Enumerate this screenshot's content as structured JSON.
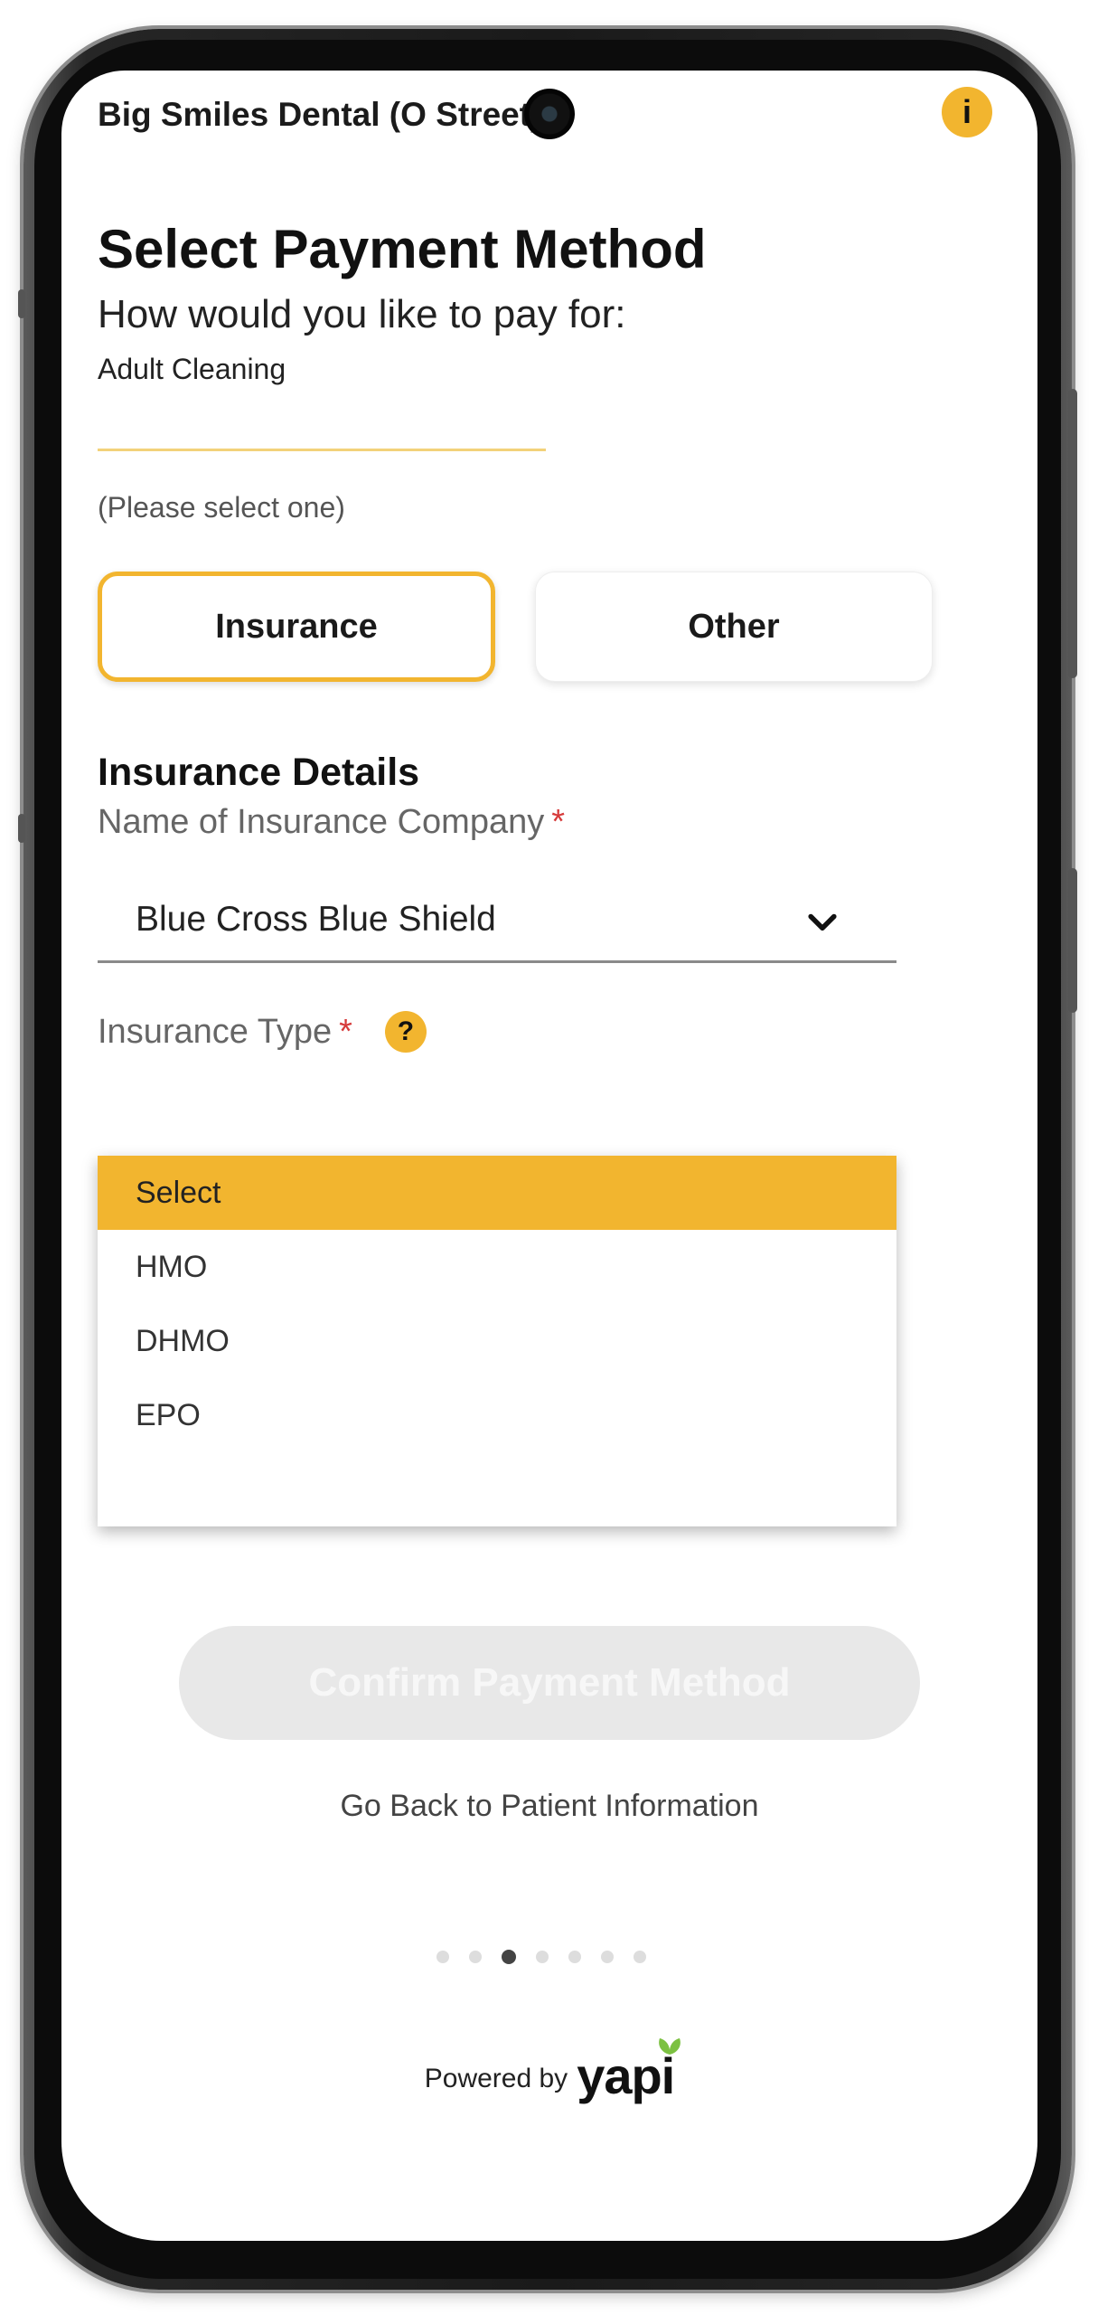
{
  "header": {
    "practice_name": "Big Smiles Dental (O Street)",
    "info_label": "i"
  },
  "main": {
    "title": "Select Payment Method",
    "subtitle": "How would you like to pay for:",
    "service_name": "Adult Cleaning",
    "select_hint": "(Please select one)",
    "payment_options": [
      {
        "label": "Insurance",
        "selected": true
      },
      {
        "label": "Other",
        "selected": false
      }
    ]
  },
  "insurance_details": {
    "section_title": "Insurance Details",
    "company_label": "Name of Insurance Company",
    "company_value": "Blue Cross Blue Shield",
    "type_label": "Insurance Type",
    "required_mark": "*",
    "help_label": "?"
  },
  "insurance_type_dropdown": {
    "options": [
      {
        "label": "Select",
        "selected": true
      },
      {
        "label": "HMO",
        "selected": false
      },
      {
        "label": "DHMO",
        "selected": false
      },
      {
        "label": "EPO",
        "selected": false
      }
    ]
  },
  "footer": {
    "confirm_label": "Confirm Payment Method",
    "back_link_label": "Go Back to Patient Information",
    "progress": {
      "total_steps": 7,
      "current_step": 3
    },
    "powered_by_label": "Powered by",
    "brand_name": "yapi"
  },
  "colors": {
    "accent": "#f2b52f",
    "required": "#d63a3a",
    "disabled_button": "#e8e8e8",
    "brand_leaf": "#7cc142"
  },
  "icons": {
    "info": "info-icon",
    "help": "question-icon",
    "dropdown": "chevron-down-icon",
    "brand": "leaf-icon"
  }
}
